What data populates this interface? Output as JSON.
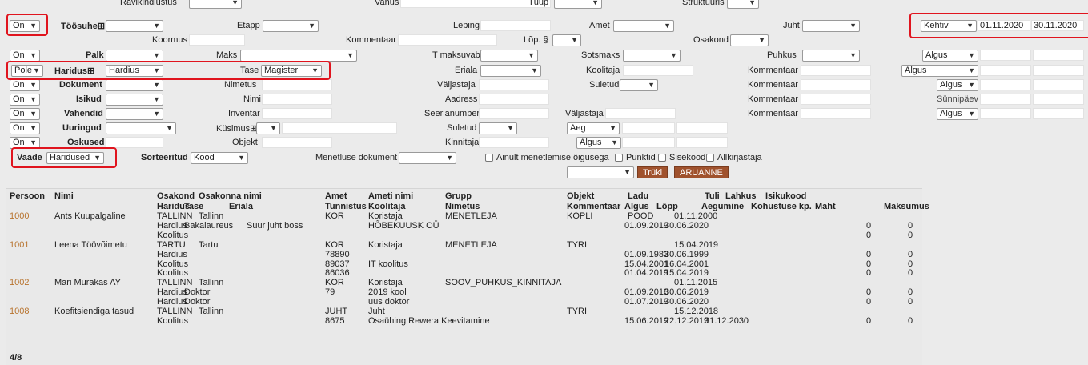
{
  "filters": {
    "ravikindlustus_label": "Ravikindlustus",
    "vanus_label": "Vanus",
    "tuup_label": "Tüüp",
    "struktuuris_label": "Struktuuris",
    "toosuhe_op": "On",
    "toosuhe_label": "Töösuhe⊞",
    "etapp_label": "Etapp",
    "leping_label": "Leping",
    "amet_label": "Amet",
    "juht_label": "Juht",
    "koormus_label": "Koormus",
    "kommentaar_label": "Kommentaar",
    "lop_label": "Lõp. §",
    "osakond_label": "Osakond",
    "palk_op": "On",
    "palk_label": "Palk",
    "maks_label": "Maks",
    "t_maksuvaba_label": "T maksuvaba",
    "sotsmaks_label": "Sotsmaks",
    "puhkus_label": "Puhkus",
    "haridus_op": "Pole",
    "haridus_label": "Haridus⊞",
    "haridus_value": "Hardius",
    "tase_label": "Tase",
    "tase_value": "Magister",
    "eriala_label": "Eriala",
    "koolitaja_label": "Koolitaja",
    "kommentaar2_label": "Kommentaar",
    "dokument_op": "On",
    "dokument_label": "Dokument",
    "nimetus_label": "Nimetus",
    "valjastaja_label": "Väljastaja",
    "suletud_label": "Suletud",
    "kommentaar3_label": "Kommentaar",
    "isikud_op": "On",
    "isikud_label": "Isikud",
    "nimi_label": "Nimi",
    "aadress_label": "Aadress",
    "kommentaar4_label": "Kommentaar",
    "vahendid_op": "On",
    "vahendid_label": "Vahendid",
    "inventar_label": "Inventar",
    "seerianumber_label": "Seerianumber",
    "valjastaja2_label": "Väljastaja",
    "kommentaar5_label": "Kommentaar",
    "uuringud_op": "On",
    "uuringud_label": "Uuringud",
    "kusimus_label": "Küsimus⊞",
    "suletud2_label": "Suletud",
    "aeg_value": "Aeg",
    "oskused_op": "On",
    "oskused_label": "Oskused",
    "objekt_label": "Objekt",
    "kinnitaja_label": "Kinnitaja",
    "algus_value": "Algus",
    "vaade_label": "Vaade",
    "vaade_value": "Haridused",
    "sorteeritud_label": "Sorteeritud",
    "sorteeritud_value": "Kood",
    "menetluse_label": "Menetluse dokument",
    "ainult_label": "Ainult menetlemise õigusega",
    "punktid_label": "Punktid",
    "sisekood_label": "Sisekood",
    "allkirjastaja_label": "Allkirjastaja",
    "truki_label": "Trüki",
    "aruanne_label": "ARUANNE"
  },
  "right_panel": {
    "kehtiv_value": "Kehtiv",
    "date_from": "01.11.2020",
    "date_to": "30.11.2020",
    "algus1": "Algus",
    "algus2": "Algus",
    "algus3": "Algus",
    "sunnipaev_label": "Sünnipäev",
    "algus4": "Algus"
  },
  "table": {
    "headers_row1": [
      "Persoon",
      "Nimi",
      "Osakond",
      "Osakonna nimi",
      "Amet",
      "Ameti nimi",
      "Grupp",
      "Objekt",
      "Ladu",
      "Tuli",
      "Lahkus",
      "Isikukood"
    ],
    "headers_row2": [
      "Haridus",
      "Tase",
      "Eriala",
      "Tunnistus",
      "Koolitaja",
      "Nimetus",
      "Kommentaar",
      "Algus",
      "Lõpp",
      "Aegumine",
      "Kohustuse kp.",
      "Maht",
      "Maksumus"
    ],
    "rows": [
      {
        "type": "person",
        "persoon": "1000",
        "nimi": "Ants Kuupalgaline",
        "osakond": "TALLINN",
        "osakonna_nimi": "Tallinn",
        "amet": "KOR",
        "ameti_nimi": "Koristaja",
        "grupp": "MENETLEJA",
        "objekt": "KOPLI",
        "ladu": "POOD",
        "tuli": "01.11.2000",
        "lahkus": "",
        "maht": "",
        "maksumus": ""
      },
      {
        "type": "sub",
        "haridus": "Hardius",
        "tase": "Bakalaureus",
        "eriala": "Suur juht boss",
        "tunnistus": "",
        "koolitaja": "HÕBEKUUSK OÜ",
        "nimetus": "",
        "algus": "01.09.2019",
        "lopp": "30.06.2020",
        "aegumine": "",
        "maht": "0",
        "maksumus": "0"
      },
      {
        "type": "sub",
        "haridus": "Koolitus",
        "tase": "",
        "eriala": "",
        "tunnistus": "",
        "koolitaja": "",
        "nimetus": "",
        "algus": "",
        "lopp": "",
        "aegumine": "",
        "maht": "0",
        "maksumus": "0"
      },
      {
        "type": "person",
        "persoon": "1001",
        "nimi": "Leena Töövõimetu",
        "osakond": "TARTU",
        "osakonna_nimi": "Tartu",
        "amet": "KOR",
        "ameti_nimi": "Koristaja",
        "grupp": "MENETLEJA",
        "objekt": "TYRI",
        "ladu": "",
        "tuli": "15.04.2019",
        "lahkus": "",
        "maht": "",
        "maksumus": ""
      },
      {
        "type": "sub",
        "haridus": "Hardius",
        "tase": "",
        "eriala": "",
        "tunnistus": "78890",
        "koolitaja": "",
        "nimetus": "",
        "algus": "01.09.1983",
        "lopp": "30.06.1999",
        "aegumine": "",
        "maht": "0",
        "maksumus": "0"
      },
      {
        "type": "sub",
        "haridus": "Koolitus",
        "tase": "",
        "eriala": "",
        "tunnistus": "89037",
        "koolitaja": "IT koolitus",
        "nimetus": "",
        "algus": "15.04.2001",
        "lopp": "16.04.2001",
        "aegumine": "",
        "maht": "0",
        "maksumus": "0"
      },
      {
        "type": "sub",
        "haridus": "Koolitus",
        "tase": "",
        "eriala": "",
        "tunnistus": "86036",
        "koolitaja": "",
        "nimetus": "",
        "algus": "01.04.2019",
        "lopp": "15.04.2019",
        "aegumine": "",
        "maht": "0",
        "maksumus": "0"
      },
      {
        "type": "person",
        "persoon": "1002",
        "nimi": "Mari Murakas AY",
        "osakond": "TALLINN",
        "osakonna_nimi": "Tallinn",
        "amet": "KOR",
        "ameti_nimi": "Koristaja",
        "grupp": "SOOV_PUHKUS_KINNITAJA",
        "objekt": "",
        "ladu": "",
        "tuli": "01.11.2015",
        "lahkus": "",
        "maht": "",
        "maksumus": ""
      },
      {
        "type": "sub",
        "haridus": "Hardius",
        "tase": "Doktor",
        "eriala": "",
        "tunnistus": "79",
        "koolitaja": "2019 kool",
        "nimetus": "",
        "algus": "01.09.2018",
        "lopp": "30.06.2019",
        "aegumine": "",
        "maht": "0",
        "maksumus": "0"
      },
      {
        "type": "sub",
        "haridus": "Hardius",
        "tase": "Doktor",
        "eriala": "",
        "tunnistus": "",
        "koolitaja": "uus doktor",
        "nimetus": "",
        "algus": "01.07.2019",
        "lopp": "30.06.2020",
        "aegumine": "",
        "maht": "0",
        "maksumus": "0"
      },
      {
        "type": "person",
        "persoon": "1008",
        "nimi": "Koefitsiendiga tasud",
        "osakond": "TALLINN",
        "osakonna_nimi": "Tallinn",
        "amet": "JUHT",
        "ameti_nimi": "Juht",
        "grupp": "",
        "objekt": "TYRI",
        "ladu": "",
        "tuli": "15.12.2018",
        "lahkus": "",
        "maht": "",
        "maksumus": ""
      },
      {
        "type": "sub",
        "haridus": "Koolitus",
        "tase": "",
        "eriala": "",
        "tunnistus": "8675",
        "koolitaja": "Osaühing Rewera Keevitamine",
        "nimetus": "",
        "algus": "15.06.2019",
        "lopp": "22.12.2019",
        "aegumine": "31.12.2030",
        "maht": "0",
        "maksumus": "0"
      }
    ],
    "footer_count": "4/8"
  },
  "colors": {
    "accent_red": "#e0141e",
    "person_link": "#b8742f",
    "button_brown": "#a0522d"
  }
}
